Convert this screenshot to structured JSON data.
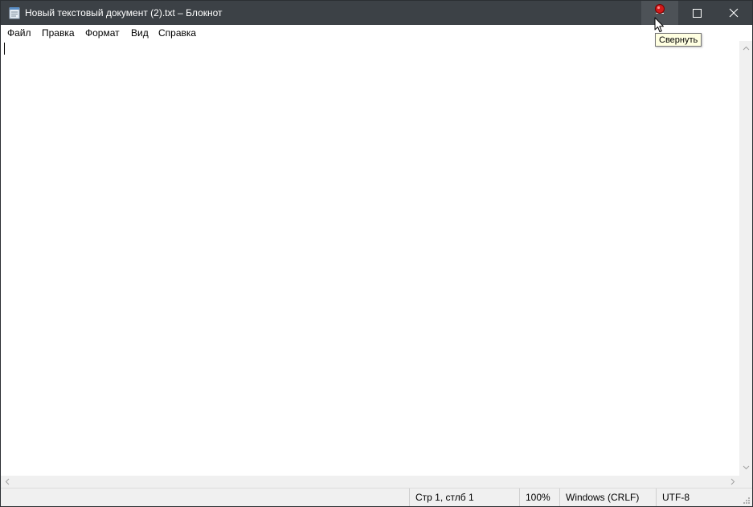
{
  "window": {
    "title": "Новый текстовый документ (2).txt – Блокнот",
    "app_icon": "notepad-icon",
    "controls": {
      "minimize_icon": "minimize-icon",
      "maximize_icon": "maximize-icon",
      "close_icon": "close-icon"
    }
  },
  "menu": {
    "items": [
      {
        "label": "Файл"
      },
      {
        "label": "Правка"
      },
      {
        "label": "Формат"
      },
      {
        "label": "Вид"
      },
      {
        "label": "Справка"
      }
    ]
  },
  "editor": {
    "content": ""
  },
  "statusbar": {
    "position": "Стр 1, стлб 1",
    "zoom": "100%",
    "line_endings": "Windows (CRLF)",
    "encoding": "UTF-8"
  },
  "tooltip": {
    "text": "Свернуть"
  },
  "colors": {
    "titlebar": "#3c4146",
    "titlebar_hover": "#4d5257",
    "tooltip_bg": "#ffffe1",
    "statusbar_bg": "#f0f0f0"
  }
}
